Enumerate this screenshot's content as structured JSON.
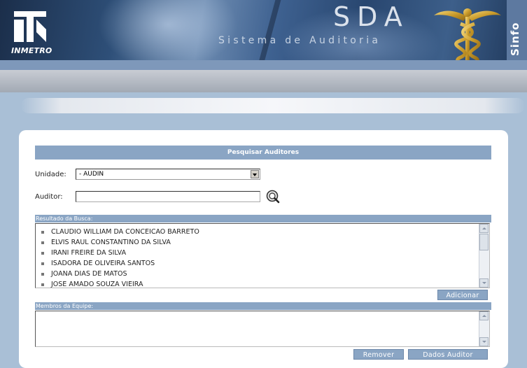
{
  "header": {
    "logo_text": "INMETRO",
    "title": "SDA",
    "subtitle": "Sistema de Auditoria",
    "side_label": "Sinfo"
  },
  "search": {
    "title": "Pesquisar Auditores",
    "unidade_label": "Unidade:",
    "unidade_value": "- AUDIN",
    "auditor_label": "Auditor:",
    "auditor_value": ""
  },
  "results": {
    "label": "Resultado da Busca:",
    "items": [
      "CLAUDIO WILLIAM DA CONCEICAO BARRETO",
      "ELVIS RAUL CONSTANTINO DA SILVA",
      "IRANI FREIRE DA SILVA",
      "ISADORA DE OLIVEIRA SANTOS",
      "JOANA DIAS DE MATOS",
      "JOSE AMADO SOUZA VIEIRA"
    ],
    "add_button": "Adicionar"
  },
  "team": {
    "label": "Membros da Equipe:",
    "items": [],
    "remove_button": "Remover",
    "details_button": "Dados Auditor"
  },
  "colors": {
    "background": "#a9bfd6",
    "accent_bar": "#8aa5c4",
    "banner_dark": "#1b2e4a"
  }
}
